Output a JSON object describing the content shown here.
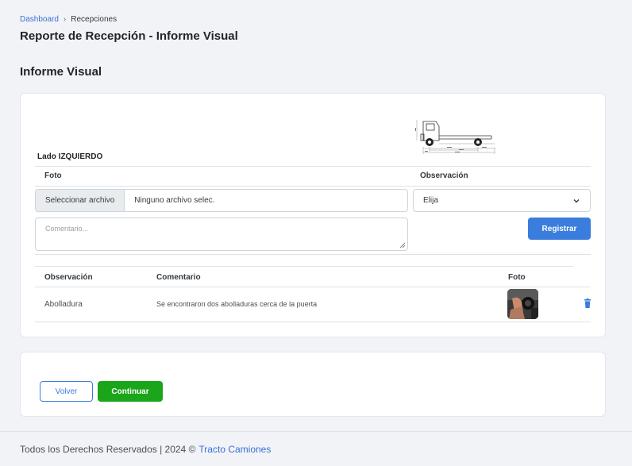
{
  "breadcrumb": {
    "home": "Dashboard",
    "separator": "›",
    "current": "Recepciones"
  },
  "page_title": "Reporte de Recepción - Informe Visual",
  "section_title": "Informe Visual",
  "form": {
    "side_label": "Lado IZQUIERDO",
    "photo_label": "Foto",
    "observation_label": "Observación",
    "file_button": "Seleccionar archivo",
    "file_name": "Ninguno archivo selec.",
    "select_value": "Elija",
    "comment_placeholder": "Comentario...",
    "register_button": "Registrar"
  },
  "table": {
    "headers": [
      "Observación",
      "Comentario",
      "Foto"
    ],
    "rows": [
      {
        "observation": "Abolladura",
        "comment": "Se encontraron dos abolladuras cerca de la puerta"
      }
    ]
  },
  "actions": {
    "back": "Volver",
    "continue": "Continuar"
  },
  "footer": {
    "text": "Todos los Derechos Reservados  | 2024 ©",
    "brand": "Tracto Camiones"
  },
  "colors": {
    "primary": "#3b7ddd",
    "success": "#1aa51a",
    "link": "#3b6fd6"
  },
  "icons": {
    "select_chevron": "chevron-down-icon",
    "delete": "trash-icon"
  }
}
